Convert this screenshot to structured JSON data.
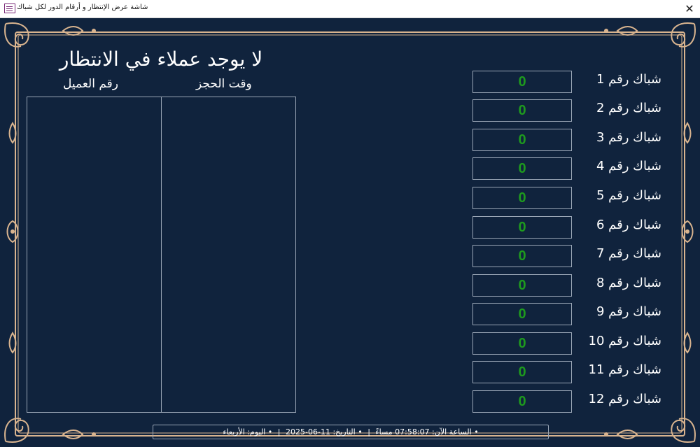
{
  "window": {
    "title": "شاشة عرض الإنتظار و أرقام الدور لكل شباك",
    "close_glyph": "✕"
  },
  "headline": "لا يوجد عملاء في الانتظار",
  "waitlist": {
    "columns": [
      "وقت الحجز",
      "رقم العميل"
    ]
  },
  "windows": [
    {
      "label": "شباك رقم 1",
      "number": "0"
    },
    {
      "label": "شباك رقم 2",
      "number": "0"
    },
    {
      "label": "شباك رقم 3",
      "number": "0"
    },
    {
      "label": "شباك رقم 4",
      "number": "0"
    },
    {
      "label": "شباك رقم 5",
      "number": "0"
    },
    {
      "label": "شباك رقم 6",
      "number": "0"
    },
    {
      "label": "شباك رقم 7",
      "number": "0"
    },
    {
      "label": "شباك رقم 8",
      "number": "0"
    },
    {
      "label": "شباك رقم 9",
      "number": "0"
    },
    {
      "label": "شباك رقم 10",
      "number": "0"
    },
    {
      "label": "شباك رقم 11",
      "number": "0"
    },
    {
      "label": "شباك رقم 12",
      "number": "0"
    }
  ],
  "status": {
    "time": "• الساعة الآن: 07:58:07 مساءً",
    "date": "• التاريخ: 11-06-2025",
    "day": "• اليوم: الأربعاء",
    "separator": "|"
  },
  "colors": {
    "background": "#10233d",
    "ornament": "#d9b48f",
    "counter_digits": "#1e9a1e",
    "text": "#ffffff"
  },
  "icons": {
    "app": "form-icon",
    "close": "close-icon"
  }
}
